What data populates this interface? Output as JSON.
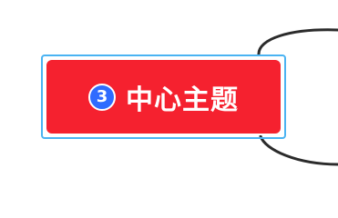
{
  "topic": {
    "priority_marker": "3",
    "title": "中心主题"
  },
  "colors": {
    "topic_fill": "#f5212f",
    "selection_outline": "#4ab3f2",
    "priority_badge": "#2f6bff",
    "connector_line": "#2b2b2b"
  },
  "icons": {
    "priority_marker": "priority-3-icon"
  }
}
